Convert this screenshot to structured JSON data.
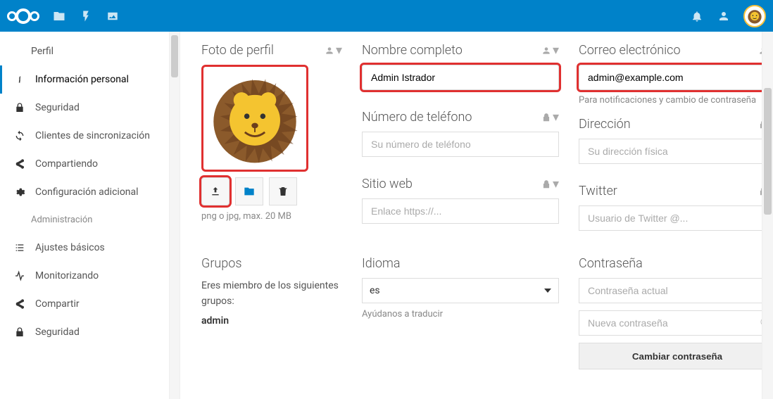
{
  "topbar": {
    "icons": [
      "files-icon",
      "flash-icon",
      "image-icon"
    ],
    "right_icons": [
      "bell-icon",
      "contacts-icon"
    ]
  },
  "sidebar": {
    "user_section": "Perfil",
    "items": [
      {
        "icon": "info-icon",
        "label": "Información personal",
        "active": true
      },
      {
        "icon": "lock-icon",
        "label": "Seguridad"
      },
      {
        "icon": "sync-icon",
        "label": "Clientes de sincronización"
      },
      {
        "icon": "share-icon",
        "label": "Compartiendo"
      },
      {
        "icon": "gear-icon",
        "label": "Configuración adicional"
      }
    ],
    "admin_section": "Administración",
    "admin_items": [
      {
        "icon": "list-icon",
        "label": "Ajustes básicos"
      },
      {
        "icon": "activity-icon",
        "label": "Monitorizando"
      },
      {
        "icon": "share-icon",
        "label": "Compartir"
      },
      {
        "icon": "lock-icon",
        "label": "Seguridad"
      }
    ]
  },
  "profile_photo": {
    "heading": "Foto de perfil",
    "hint": "png o jpg, max. 20 MB"
  },
  "fullname": {
    "heading": "Nombre completo",
    "value": "Admin Istrador"
  },
  "email": {
    "heading": "Correo electrónico",
    "value": "admin@example.com",
    "sub": "Para notificaciones y cambio de contraseña"
  },
  "phone": {
    "heading": "Número de teléfono",
    "placeholder": "Su número de teléfono"
  },
  "address": {
    "heading": "Dirección",
    "placeholder": "Su dirección física"
  },
  "website": {
    "heading": "Sitio web",
    "placeholder": "Enlace https://..."
  },
  "twitter": {
    "heading": "Twitter",
    "placeholder": "Usuario de Twitter @..."
  },
  "groups": {
    "heading": "Grupos",
    "text": "Eres miembro de los siguientes grupos:",
    "name": "admin"
  },
  "language": {
    "heading": "Idioma",
    "value": "es",
    "help": "Ayúdanos a traducir"
  },
  "password": {
    "heading": "Contraseña",
    "current_ph": "Contraseña actual",
    "new_ph": "Nueva contraseña",
    "button": "Cambiar contraseña"
  }
}
